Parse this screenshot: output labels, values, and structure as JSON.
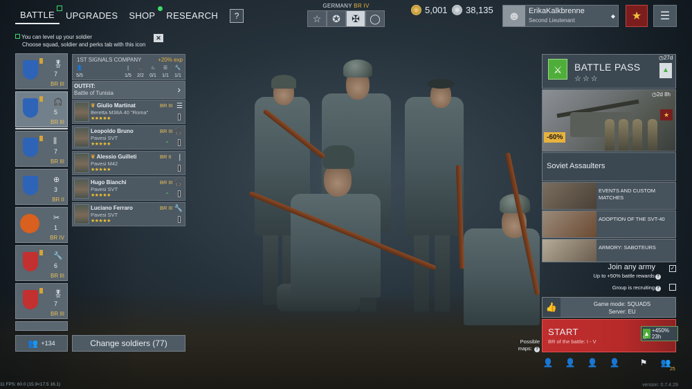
{
  "nav": {
    "tabs": [
      {
        "label": "BATTLE",
        "active": true,
        "indicator": "square"
      },
      {
        "label": "UPGRADES"
      },
      {
        "label": "SHOP",
        "indicator": "dot"
      },
      {
        "label": "RESEARCH"
      }
    ],
    "help_label": "?"
  },
  "mode_switch": {
    "nation": "GERMANY",
    "br": "BR IV",
    "modes": [
      "star-outline-icon",
      "star-circle-icon",
      "iron-cross-icon",
      "ring-icon"
    ],
    "selected": 2
  },
  "currency": {
    "gold": "5,001",
    "silver": "38,135",
    "gold_color": "#d4a437",
    "silver_color": "#b8c0c6"
  },
  "profile": {
    "name": "ErikaKalkbrenne",
    "rank": "Second Lieutenant"
  },
  "hint": {
    "line1": "You can level up your soldier",
    "line2": "Choose squad, soldier and perks tab with this icon",
    "close": "✕"
  },
  "squads": [
    {
      "count": "7",
      "br": "BR III",
      "icon": "medal-icon",
      "emblem_color": "#2e64b8"
    },
    {
      "count": "5",
      "br": "BR III",
      "icon": "headset-icon",
      "emblem_color": "#2e64b8"
    },
    {
      "count": "7",
      "br": "BR III",
      "icon": "rifles-icon",
      "emblem_color": "#2e64b8"
    },
    {
      "count": "3",
      "br": "BR II",
      "icon": "crosshair-icon",
      "emblem_color": "#2e64b8"
    },
    {
      "count": "1",
      "br": "BR IV",
      "icon": "tools-icon",
      "emblem_color": "#d9601e"
    },
    {
      "count": "6",
      "br": "BR III",
      "icon": "wrench-icon",
      "emblem_color": "#c23030"
    },
    {
      "count": "7",
      "br": "BR III",
      "icon": "medal-icon",
      "emblem_color": "#c23030"
    }
  ],
  "add_soldier": {
    "count": "+134"
  },
  "change_soldiers": "Change soldiers (77)",
  "company": {
    "name": "1ST SIGNALS COMPANY",
    "exp": "+20% exp",
    "stats": [
      "5/5",
      "1/5",
      "2/2",
      "0/1",
      "1/1",
      "1/1"
    ]
  },
  "outfit": {
    "label": "OUTFIT:",
    "value": "Battle of Tunisia"
  },
  "soldiers": [
    {
      "name": "Giulio Martinat",
      "weapon": "Beretta M38A 40 \"Roma\"",
      "br": "BR III",
      "stars": "★★★★★",
      "class_icon": "list-icon",
      "has_medal": true
    },
    {
      "name": "Leopoldo Bruno",
      "weapon": "Pavesi SVT",
      "br": "BR III",
      "stars": "★★★★★",
      "class_icon": "headset-icon",
      "has_medal": false
    },
    {
      "name": "Alessio Guilleti",
      "weapon": "Pavesi M42",
      "br": "BR II",
      "stars": "★★★★★",
      "class_icon": "bullet-icon",
      "has_medal": true
    },
    {
      "name": "Hugo Bianchi",
      "weapon": "Pavesi SVT",
      "br": "BR III",
      "stars": "★★★★★",
      "class_icon": "headset-icon",
      "has_medal": false
    },
    {
      "name": "Luciano Ferraro",
      "weapon": "Pavesi SVT",
      "br": "BR III",
      "stars": "★★★★★",
      "class_icon": "wrench-icon",
      "has_medal": false
    }
  ],
  "battle_pass": {
    "title": "BATTLE PASS",
    "stars": "☆☆☆",
    "timer": "27d"
  },
  "offer": {
    "discount": "-60%",
    "timer": "2d 8h",
    "name": "Soviet Assaulters"
  },
  "news": [
    {
      "title": "EVENTS AND CUSTOM MATCHES"
    },
    {
      "title": "ADOPTION OF THE SVT-40"
    },
    {
      "title": "ARMORY: SABOTEURS"
    }
  ],
  "join": {
    "title": "Join any army",
    "bonus": "Up to +50% battle rewards",
    "recruiting": "Group is recruiting"
  },
  "game_mode": {
    "mode": "Game mode: SQUADS",
    "server": "Server: EU"
  },
  "start": {
    "label": "START",
    "br": "BR of the battle: I - V",
    "xp_bonus": "+450% 23h",
    "xp_label": "XP"
  },
  "maps_label": "Possible maps:",
  "bottom_count": "25",
  "version": "version: 0.7.4.29",
  "debug": "11 FPS: 60.0 (15.9<17.5 16.1)"
}
